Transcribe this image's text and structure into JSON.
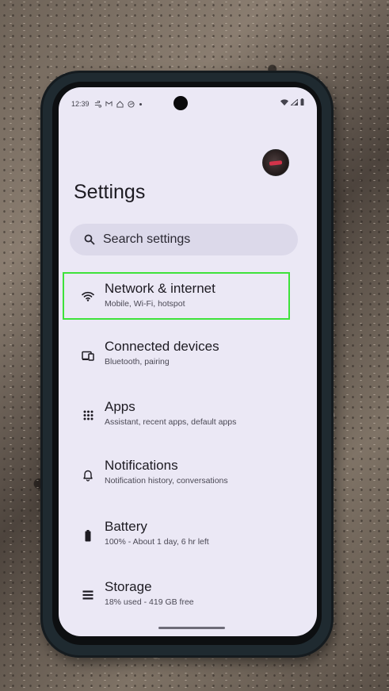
{
  "status_bar": {
    "time": "12:39",
    "notification_icons": [
      "wind-icon",
      "gmail-icon",
      "home-icon",
      "messenger-icon",
      "dot-icon"
    ]
  },
  "header": {
    "title": "Settings"
  },
  "search": {
    "placeholder": "Search settings"
  },
  "settings_items": [
    {
      "icon": "wifi-icon",
      "title": "Network & internet",
      "subtitle": "Mobile, Wi-Fi, hotspot",
      "highlighted": true
    },
    {
      "icon": "connected-devices-icon",
      "title": "Connected devices",
      "subtitle": "Bluetooth, pairing",
      "highlighted": false
    },
    {
      "icon": "apps-grid-icon",
      "title": "Apps",
      "subtitle": "Assistant, recent apps, default apps",
      "highlighted": false
    },
    {
      "icon": "bell-icon",
      "title": "Notifications",
      "subtitle": "Notification history, conversations",
      "highlighted": false
    },
    {
      "icon": "battery-icon",
      "title": "Battery",
      "subtitle": "100% - About 1 day, 6 hr left",
      "highlighted": false
    },
    {
      "icon": "storage-icon",
      "title": "Storage",
      "subtitle": "18% used - 419 GB free",
      "highlighted": false
    }
  ],
  "colors": {
    "screen_background": "#ebe8f5",
    "search_background": "#dcd9ea",
    "highlight": "#3ee23a",
    "text_primary": "#1d1b22"
  }
}
